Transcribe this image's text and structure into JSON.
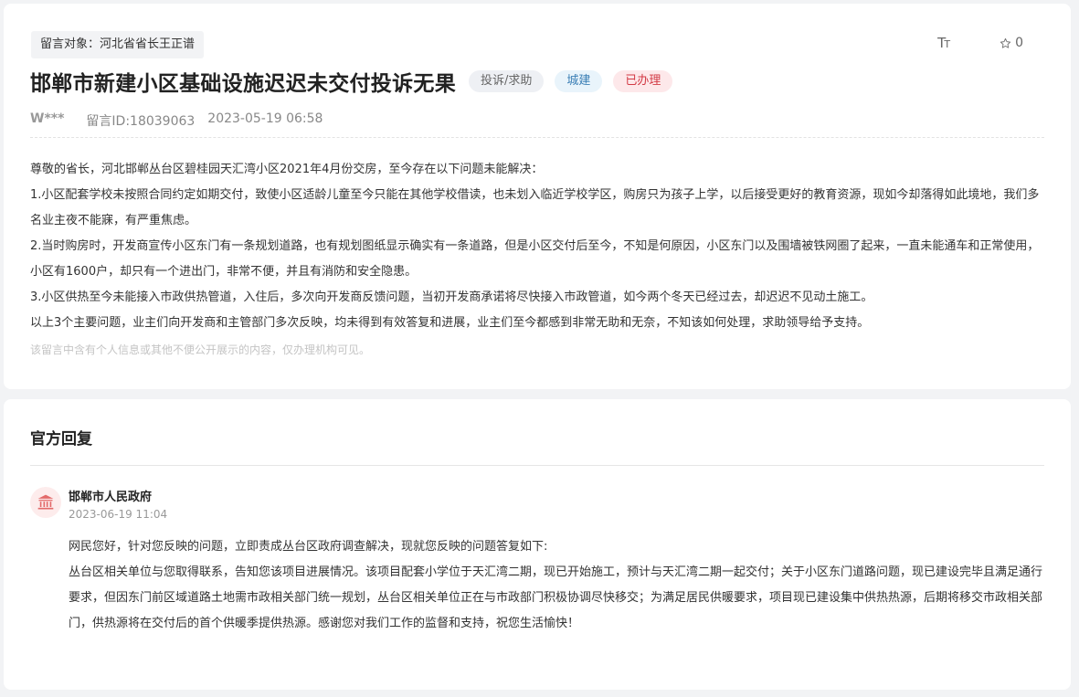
{
  "message": {
    "target_label": "留言对象：河北省省长王正谱",
    "font_toggle_label": "TT",
    "favorite_count": "0",
    "title": "邯郸市新建小区基础设施迟迟未交付投诉无果",
    "tags": {
      "type": "投诉/求助",
      "category": "城建",
      "status": "已办理"
    },
    "author": "W***",
    "message_id": "留言ID:18039063",
    "time": "2023-05-19 06:58",
    "paragraphs": [
      "尊敬的省长，河北邯郸丛台区碧桂园天汇湾小区2021年4月份交房，至今存在以下问题未能解决：",
      "1.小区配套学校未按照合同约定如期交付，致使小区适龄儿童至今只能在其他学校借读，也未划入临近学校学区，购房只为孩子上学，以后接受更好的教育资源，现如今却落得如此境地，我们多名业主夜不能寐，有严重焦虑。",
      "2.当时购房时，开发商宣传小区东门有一条规划道路，也有规划图纸显示确实有一条道路，但是小区交付后至今，不知是何原因，小区东门以及围墙被铁网圈了起来，一直未能通车和正常使用，小区有1600户，却只有一个进出门，非常不便，并且有消防和安全隐患。",
      "3.小区供热至今未能接入市政供热管道，入住后，多次向开发商反馈问题，当初开发商承诺将尽快接入市政管道，如今两个冬天已经过去，却迟迟不见动土施工。",
      "以上3个主要问题，业主们向开发商和主管部门多次反映，均未得到有效答复和进展，业主们至今都感到非常无助和无奈，不知该如何处理，求助领导给予支持。"
    ],
    "privacy_note": "该留言中含有个人信息或其他不便公开展示的内容，仅办理机构可见。"
  },
  "reply": {
    "heading": "官方回复",
    "org_name": "邯郸市人民政府",
    "time": "2023-06-19 11:04",
    "paragraphs": [
      "网民您好，针对您反映的问题，立即责成丛台区政府调查解决，现就您反映的问题答复如下:",
      "丛台区相关单位与您取得联系，告知您该项目进展情况。该项目配套小学位于天汇湾二期，现已开始施工，预计与天汇湾二期一起交付；关于小区东门道路问题，现已建设完毕且满足通行要求，但因东门前区域道路土地需市政相关部门统一规划，丛台区相关单位正在与市政部门积极协调尽快移交；为满足居民供暖要求，项目现已建设集中供热热源，后期将移交市政相关部门，供热源将在交付后的首个供暖季提供热源。感谢您对我们工作的监督和支持，祝您生活愉快！"
    ]
  },
  "icons": {
    "font": "font-size-icon",
    "favorite": "star-icon",
    "government": "government-building-icon"
  },
  "colors": {
    "status_red": "#d33a45",
    "category_blue": "#3b7fb5"
  }
}
